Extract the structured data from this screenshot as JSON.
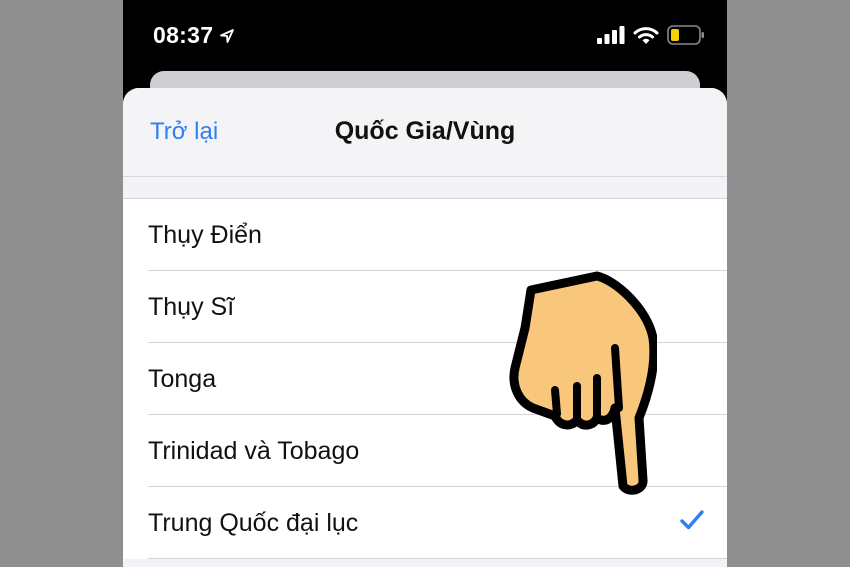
{
  "status_bar": {
    "time": "08:37",
    "icons": [
      "location-arrow-icon",
      "signal-bars-icon",
      "wifi-icon",
      "battery-icon"
    ],
    "battery_color": "#f5d000"
  },
  "nav": {
    "back_label": "Trở lại",
    "title": "Quốc Gia/Vùng"
  },
  "list": {
    "items": [
      {
        "label": "Thụy Điển",
        "selected": false
      },
      {
        "label": "Thụy Sĩ",
        "selected": false
      },
      {
        "label": "Tonga",
        "selected": false
      },
      {
        "label": "Trinidad và Tobago",
        "selected": false
      },
      {
        "label": "Trung Quốc đại lục",
        "selected": true
      }
    ],
    "check_icon": "checkmark-icon"
  },
  "overlay": {
    "icon": "pointing-hand-icon",
    "fill_color": "#f8c77c"
  },
  "colors": {
    "accent": "#2f7ef6",
    "background": "#8f8f8f"
  }
}
